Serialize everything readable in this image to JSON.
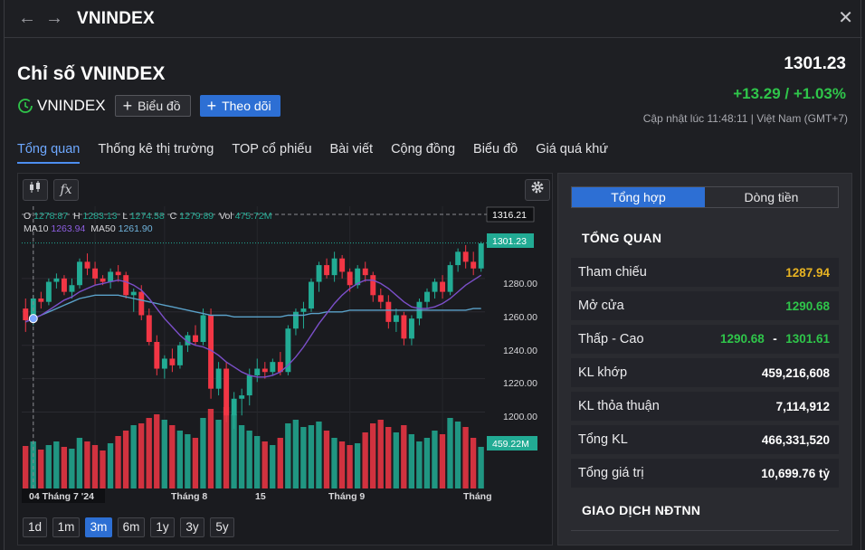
{
  "window": {
    "title": "VNINDEX"
  },
  "header": {
    "title": "Chỉ số VNINDEX",
    "symbol": "VNINDEX",
    "btn_chart": "Biểu đồ",
    "btn_follow": "Theo dõi",
    "price": "1301.23",
    "change": "+13.29 / +1.03%",
    "updated": "Cập nhật lúc  11:48:11 | Việt Nam (GMT+7)"
  },
  "tabs": [
    "Tổng quan",
    "Thống kê thị trường",
    "TOP cổ phiếu",
    "Bài viết",
    "Cộng đồng",
    "Biểu đồ",
    "Giá quá khứ"
  ],
  "chart": {
    "tool_candle_icon": "candlestick-icon",
    "tool_fx_label": "fx",
    "ohlc": {
      "o_label": "O",
      "o": "1278.87",
      "h_label": "H",
      "h": "1283.13",
      "l_label": "L",
      "l": "1274.58",
      "c_label": "C",
      "c": "1279.89",
      "vol_label": "Vol",
      "vol": "475.72M"
    },
    "ma": {
      "ma10_label": "MA10",
      "ma10": "1263.94",
      "ma50_label": "MA50",
      "ma50": "1261.90"
    },
    "price_ticks": [
      "1280.00",
      "1260.00",
      "1240.00",
      "1220.00",
      "1200.00"
    ],
    "crosshair_price": "1316.21",
    "last_price": "1301.23",
    "last_volume": "459.22M",
    "x_labels": {
      "crosshair_date": "04 Tháng 7 '24",
      "aug": "Tháng 8",
      "d15": "15",
      "sep": "Tháng 9",
      "last": "Tháng"
    },
    "ranges": [
      "1d",
      "1m",
      "3m",
      "6m",
      "1y",
      "3y",
      "5y"
    ],
    "active_range": "3m",
    "colors": {
      "up": "#22ab94",
      "down": "#f23645",
      "ma10": "#7b4fc9",
      "ma50": "#5aa1c9"
    }
  },
  "chart_data": {
    "type": "candlestick",
    "ohlc": [
      [
        1262,
        1268,
        1248,
        1255
      ],
      [
        1255,
        1270,
        1252,
        1268
      ],
      [
        1268,
        1272,
        1262,
        1266
      ],
      [
        1266,
        1280,
        1264,
        1278
      ],
      [
        1278,
        1283,
        1274,
        1280
      ],
      [
        1280,
        1282,
        1270,
        1272
      ],
      [
        1272,
        1280,
        1268,
        1276
      ],
      [
        1276,
        1292,
        1274,
        1290
      ],
      [
        1290,
        1295,
        1282,
        1286
      ],
      [
        1286,
        1290,
        1276,
        1280
      ],
      [
        1280,
        1282,
        1276,
        1278
      ],
      [
        1278,
        1286,
        1274,
        1284
      ],
      [
        1284,
        1288,
        1278,
        1282
      ],
      [
        1282,
        1284,
        1268,
        1270
      ],
      [
        1270,
        1274,
        1260,
        1272
      ],
      [
        1272,
        1276,
        1255,
        1258
      ],
      [
        1258,
        1262,
        1240,
        1242
      ],
      [
        1242,
        1246,
        1222,
        1226
      ],
      [
        1226,
        1234,
        1220,
        1232
      ],
      [
        1232,
        1238,
        1224,
        1228
      ],
      [
        1228,
        1242,
        1226,
        1240
      ],
      [
        1240,
        1248,
        1236,
        1246
      ],
      [
        1246,
        1252,
        1240,
        1242
      ],
      [
        1242,
        1262,
        1240,
        1258
      ],
      [
        1258,
        1262,
        1208,
        1214
      ],
      [
        1214,
        1230,
        1210,
        1226
      ],
      [
        1226,
        1230,
        1194,
        1198
      ],
      [
        1198,
        1212,
        1190,
        1208
      ],
      [
        1208,
        1214,
        1198,
        1210
      ],
      [
        1210,
        1226,
        1204,
        1222
      ],
      [
        1222,
        1232,
        1218,
        1226
      ],
      [
        1226,
        1230,
        1220,
        1224
      ],
      [
        1224,
        1232,
        1222,
        1230
      ],
      [
        1230,
        1236,
        1222,
        1224
      ],
      [
        1224,
        1252,
        1222,
        1250
      ],
      [
        1250,
        1262,
        1246,
        1260
      ],
      [
        1260,
        1266,
        1250,
        1262
      ],
      [
        1262,
        1280,
        1260,
        1278
      ],
      [
        1278,
        1290,
        1272,
        1288
      ],
      [
        1288,
        1292,
        1280,
        1282
      ],
      [
        1282,
        1296,
        1278,
        1292
      ],
      [
        1292,
        1294,
        1280,
        1284
      ],
      [
        1284,
        1286,
        1272,
        1276
      ],
      [
        1276,
        1288,
        1274,
        1286
      ],
      [
        1286,
        1290,
        1278,
        1282
      ],
      [
        1282,
        1284,
        1266,
        1270
      ],
      [
        1270,
        1274,
        1262,
        1266
      ],
      [
        1266,
        1270,
        1250,
        1254
      ],
      [
        1254,
        1262,
        1248,
        1258
      ],
      [
        1258,
        1260,
        1240,
        1244
      ],
      [
        1244,
        1258,
        1240,
        1256
      ],
      [
        1256,
        1268,
        1252,
        1266
      ],
      [
        1266,
        1274,
        1262,
        1272
      ],
      [
        1272,
        1280,
        1268,
        1278
      ],
      [
        1278,
        1282,
        1268,
        1272
      ],
      [
        1272,
        1290,
        1270,
        1288
      ],
      [
        1288,
        1298,
        1284,
        1296
      ],
      [
        1296,
        1300,
        1286,
        1290
      ],
      [
        1290,
        1296,
        1282,
        1286
      ],
      [
        1286,
        1302,
        1284,
        1301
      ]
    ],
    "volume": [
      470,
      520,
      430,
      480,
      520,
      460,
      440,
      560,
      520,
      480,
      420,
      500,
      580,
      640,
      700,
      720,
      780,
      820,
      760,
      700,
      640,
      600,
      560,
      780,
      880,
      760,
      900,
      820,
      700,
      640,
      580,
      520,
      480,
      560,
      720,
      760,
      680,
      700,
      740,
      640,
      560,
      520,
      480,
      500,
      620,
      720,
      760,
      680,
      620,
      700,
      600,
      520,
      560,
      640,
      600,
      780,
      740,
      680,
      560,
      460
    ],
    "ma10": [
      1254,
      1256,
      1258,
      1261,
      1264,
      1267,
      1269,
      1272,
      1274,
      1276,
      1277,
      1278,
      1279,
      1278,
      1276,
      1273,
      1268,
      1262,
      1256,
      1251,
      1246,
      1242,
      1240,
      1239,
      1237,
      1234,
      1230,
      1227,
      1224,
      1222,
      1221,
      1221,
      1222,
      1224,
      1228,
      1233,
      1239,
      1246,
      1253,
      1259,
      1265,
      1270,
      1274,
      1277,
      1279,
      1279,
      1277,
      1274,
      1270,
      1266,
      1263,
      1262,
      1262,
      1263,
      1265,
      1268,
      1272,
      1276,
      1279,
      1282
    ],
    "ma50": [
      1254,
      1256,
      1258,
      1260,
      1262,
      1264,
      1266,
      1268,
      1269,
      1270,
      1270,
      1270,
      1270,
      1269,
      1268,
      1267,
      1266,
      1265,
      1264,
      1263,
      1262,
      1261,
      1260,
      1259,
      1258,
      1258,
      1258,
      1257,
      1257,
      1257,
      1257,
      1257,
      1257,
      1257,
      1258,
      1258,
      1258,
      1259,
      1259,
      1260,
      1260,
      1260,
      1261,
      1261,
      1261,
      1261,
      1261,
      1261,
      1261,
      1261,
      1261,
      1261,
      1261,
      1261,
      1261,
      1261,
      1261,
      1261,
      1262,
      1262
    ],
    "ylim": [
      1190,
      1320
    ]
  },
  "side": {
    "seg": [
      "Tổng hợp",
      "Dòng tiền"
    ],
    "active_seg": 0,
    "section_overview": "TỔNG QUAN",
    "rows": [
      {
        "label": "Tham chiếu",
        "value": "1287.94",
        "color": "yellow"
      },
      {
        "label": "Mở cửa",
        "value": "1290.68",
        "color": "green"
      },
      {
        "label": "Thấp - Cao",
        "low": "1290.68",
        "sep": "-",
        "high": "1301.61"
      },
      {
        "label": "KL khớp",
        "value": "459,216,608"
      },
      {
        "label": "KL thỏa thuận",
        "value": "7,114,912"
      },
      {
        "label": "Tổng KL",
        "value": "466,331,520"
      },
      {
        "label": "Tổng giá trị",
        "value": "10,699.76 tỷ"
      }
    ],
    "section_foreign": "GIAO DỊCH NĐTNN"
  }
}
